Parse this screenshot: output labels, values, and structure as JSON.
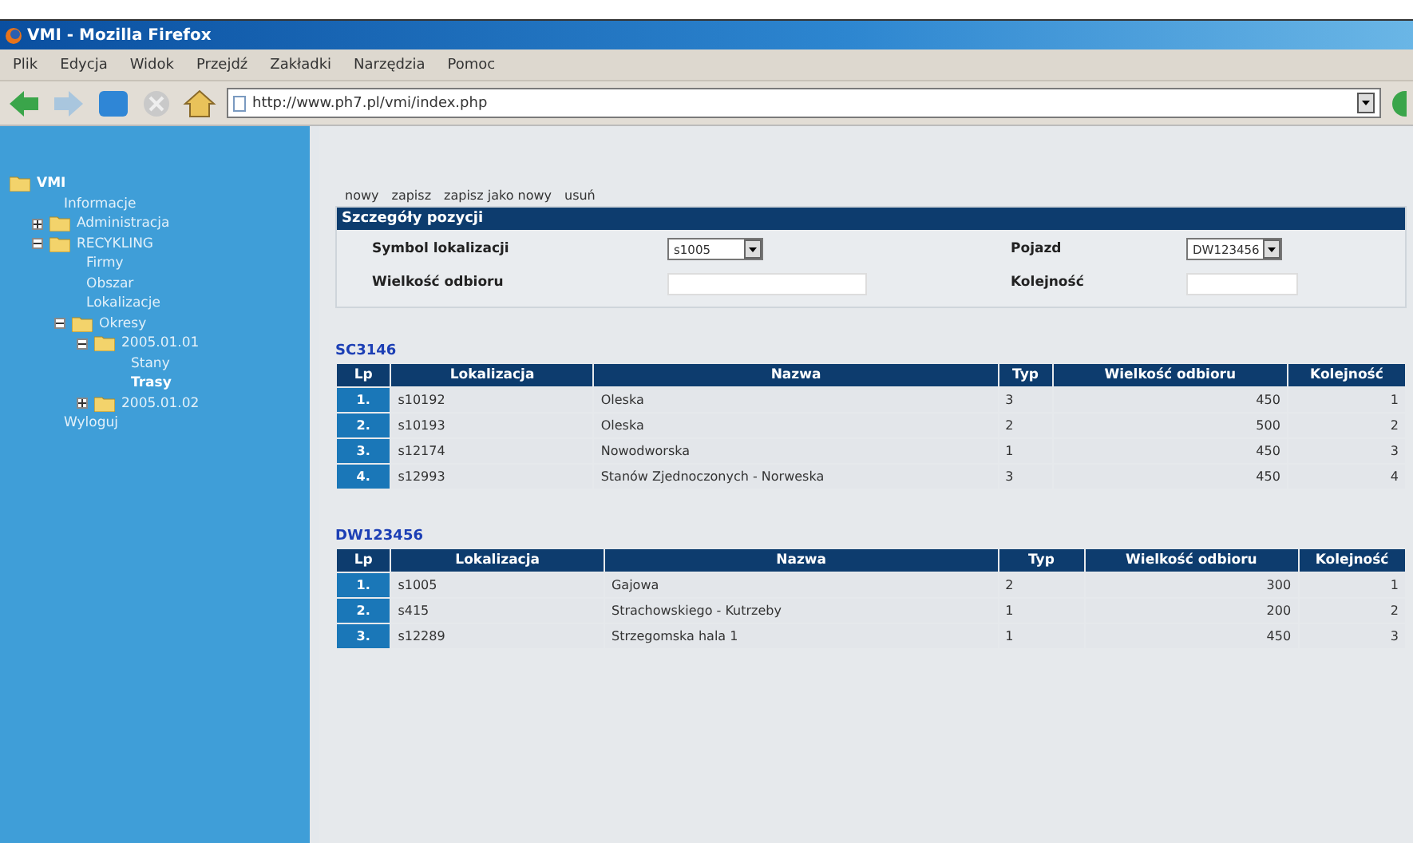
{
  "window": {
    "title": "VMI - Mozilla Firefox"
  },
  "menu": [
    "Plik",
    "Edycja",
    "Widok",
    "Przejdź",
    "Zakładki",
    "Narzędzia",
    "Pomoc"
  ],
  "address": {
    "value": "http://www.ph7.pl/vmi/index.php"
  },
  "sidebar": {
    "root": {
      "label": "VMI",
      "children": [
        {
          "label": "Informacje",
          "kind": "leaf",
          "selected": false
        },
        {
          "label": "Administracja",
          "kind": "folder",
          "expanded": false,
          "selected": false
        },
        {
          "label": "RECYKLING",
          "kind": "folder",
          "expanded": true,
          "selected": false,
          "children": [
            {
              "label": "Firmy",
              "kind": "leaf",
              "selected": false
            },
            {
              "label": "Obszar",
              "kind": "leaf",
              "selected": false
            },
            {
              "label": "Lokalizacje",
              "kind": "leaf",
              "selected": false
            },
            {
              "label": "Okresy",
              "kind": "folder",
              "expanded": true,
              "selected": false,
              "children": [
                {
                  "label": "2005.01.01",
                  "kind": "folder",
                  "expanded": true,
                  "selected": false,
                  "children": [
                    {
                      "label": "Stany",
                      "kind": "leaf",
                      "selected": false
                    },
                    {
                      "label": "Trasy",
                      "kind": "leaf",
                      "selected": true
                    }
                  ]
                },
                {
                  "label": "2005.01.02",
                  "kind": "folder",
                  "expanded": false,
                  "selected": false
                }
              ]
            }
          ]
        },
        {
          "label": "Wyloguj",
          "kind": "leaf",
          "selected": false
        }
      ]
    }
  },
  "actions": [
    "nowy",
    "zapisz",
    "zapisz jako nowy",
    "usuń"
  ],
  "form": {
    "title": "Szczegóły pozycji",
    "fields": [
      {
        "label": "Symbol lokalizacji",
        "kind": "select",
        "value": "s1005"
      },
      {
        "label": "Pojazd",
        "kind": "select",
        "value": "DW123456"
      },
      {
        "label": "Wielkość odbioru",
        "kind": "input"
      },
      {
        "label": "Kolejność",
        "kind": "input"
      }
    ]
  },
  "tables": [
    {
      "title": "SC3146",
      "columns": [
        "Lp",
        "Lokalizacja",
        "Nazwa",
        "Typ",
        "Wielkość odbioru",
        "Kolejność"
      ],
      "rows": [
        [
          "1.",
          "s10192",
          "Oleska",
          "3",
          "450",
          "1"
        ],
        [
          "2.",
          "s10193",
          "Oleska",
          "2",
          "500",
          "2"
        ],
        [
          "3.",
          "s12174",
          "Nowodworska",
          "1",
          "450",
          "3"
        ],
        [
          "4.",
          "s12993",
          "Stanów Zjednoczonych - Norweska",
          "3",
          "450",
          "4"
        ]
      ]
    },
    {
      "title": "DW123456",
      "columns": [
        "Lp",
        "Lokalizacja",
        "Nazwa",
        "Typ",
        "Wielkość odbioru",
        "Kolejność"
      ],
      "rows": [
        [
          "1.",
          "s1005",
          "Gajowa",
          "2",
          "300",
          "1"
        ],
        [
          "2.",
          "s415",
          "Strachowskiego - Kutrzeby",
          "1",
          "200",
          "2"
        ],
        [
          "3.",
          "s12289",
          "Strzegomska hala 1",
          "1",
          "450",
          "3"
        ]
      ]
    }
  ]
}
